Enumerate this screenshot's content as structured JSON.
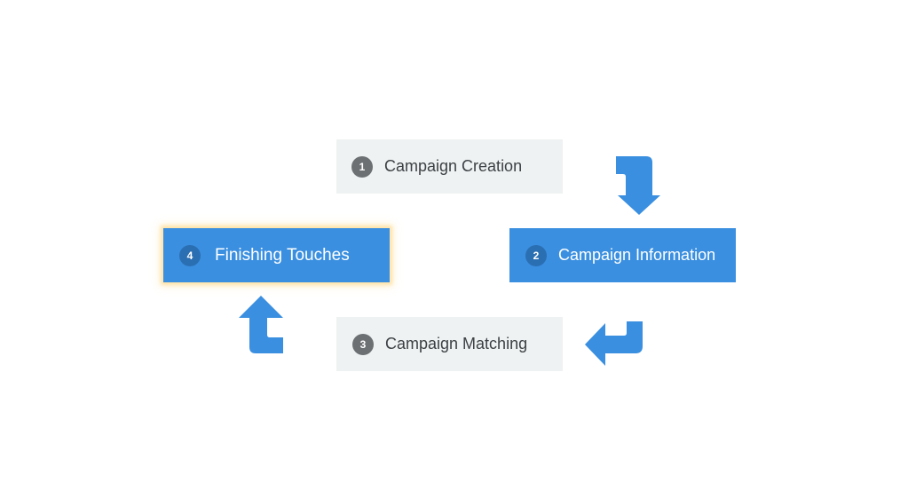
{
  "steps": [
    {
      "number": "1",
      "label": "Campaign Creation",
      "state": "inactive"
    },
    {
      "number": "2",
      "label": "Campaign Information",
      "state": "active"
    },
    {
      "number": "3",
      "label": "Campaign Matching",
      "state": "inactive"
    },
    {
      "number": "4",
      "label": "Finishing Touches",
      "state": "active-focused"
    }
  ],
  "colors": {
    "active": "#3a8fe0",
    "inactive": "#eff2f2",
    "arrow": "#3a8fe0",
    "badge_inactive": "#6d7073",
    "badge_active": "#2b6fb3"
  },
  "arrows": [
    {
      "from": "1",
      "to": "2",
      "icon": "bent-arrow-down-icon"
    },
    {
      "from": "2",
      "to": "3",
      "icon": "bent-arrow-left-icon"
    },
    {
      "from": "3",
      "to": "4",
      "icon": "bent-arrow-up-icon"
    }
  ]
}
